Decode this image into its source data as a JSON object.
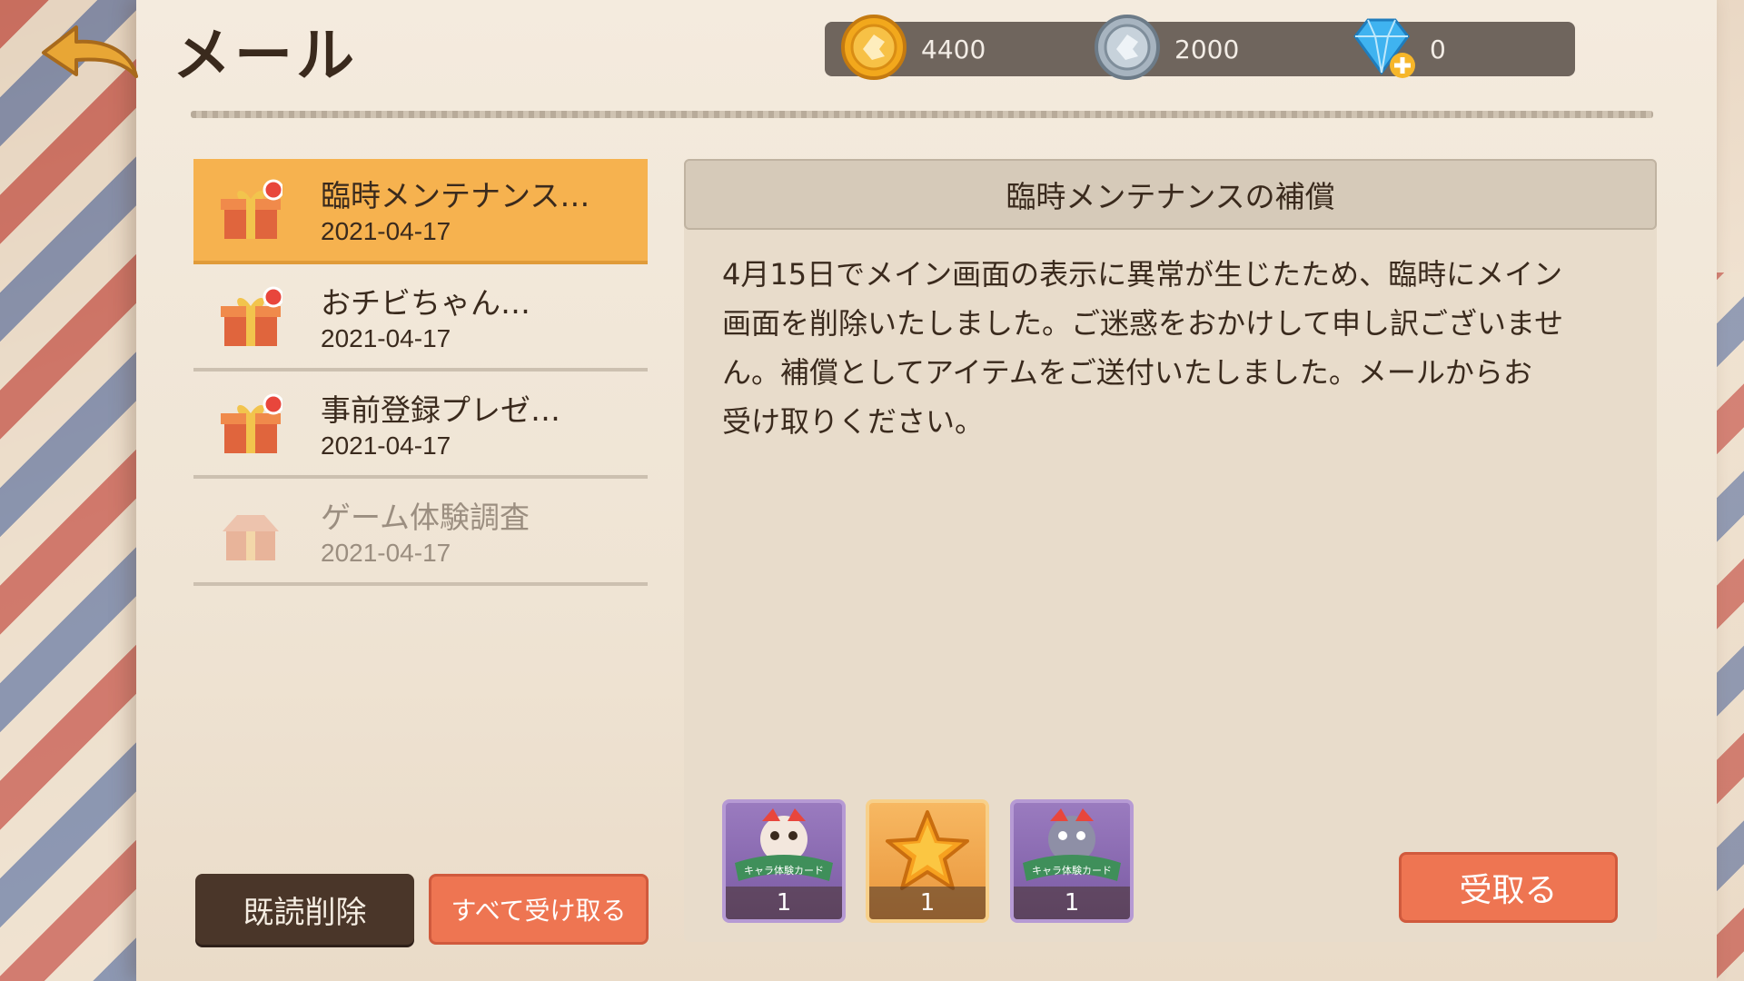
{
  "header": {
    "title": "メール"
  },
  "currencies": [
    {
      "name": "gold-coin",
      "value": "4400"
    },
    {
      "name": "silver-coin",
      "value": "2000"
    },
    {
      "name": "diamond",
      "value": "0"
    }
  ],
  "mail_list": [
    {
      "subject": "臨時メンテナンス…",
      "date": "2021-04-17",
      "state": "selected-unread"
    },
    {
      "subject": "おチビちゃん…",
      "date": "2021-04-17",
      "state": "unread"
    },
    {
      "subject": "事前登録プレゼ…",
      "date": "2021-04-17",
      "state": "unread"
    },
    {
      "subject": "ゲーム体験調査",
      "date": "2021-04-17",
      "state": "read"
    }
  ],
  "detail": {
    "title": "臨時メンテナンスの補償",
    "body": "4月15日でメイン画面の表示に異常が生じたため、臨時にメイン\n画面を削除いたしました。ご迷惑をおかけして申し訳ございませ\nん。補償としてアイテムをご送付いたしました。メールからお\n受け取りください。",
    "rewards": [
      {
        "icon": "character-trial-card-icon",
        "quantity": "1",
        "banner": "キャラ体験カード"
      },
      {
        "icon": "star-icon",
        "quantity": "1"
      },
      {
        "icon": "character-trial-card-icon",
        "quantity": "1",
        "banner": "キャラ体験カード"
      }
    ]
  },
  "buttons": {
    "delete_read": "既読削除",
    "claim_all": "すべて受け取る",
    "claim": "受取る"
  },
  "colors": {
    "accent_orange": "#ee7552",
    "selected_item": "#f6b24f",
    "dark_button": "#4a3629",
    "unread_dot": "#e8463c"
  }
}
